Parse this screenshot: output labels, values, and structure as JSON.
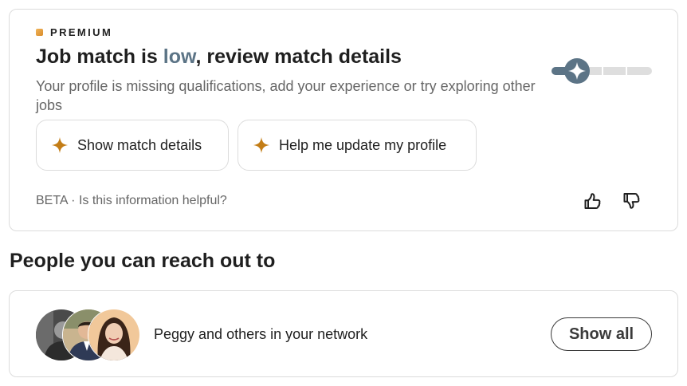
{
  "premium_card": {
    "badge": "PREMIUM",
    "headline_prefix": "Job match is ",
    "headline_highlight": "low",
    "headline_suffix": ", review match details",
    "subtitle": "Your profile is missing qualifications, add your experience or try exploring other jobs",
    "buttons": [
      {
        "label": "Show match details",
        "icon": "sparkle-icon"
      },
      {
        "label": "Help me update my profile",
        "icon": "sparkle-icon"
      }
    ],
    "match_level": "low",
    "footer": "BETA · Is this information helpful?",
    "feedback_icons": [
      "thumbs-up-icon",
      "thumbs-down-icon"
    ]
  },
  "people_section": {
    "title": "People you can reach out to",
    "network_text": "Peggy and others in your network",
    "show_all_label": "Show all",
    "avatars": [
      "avatar-person-1",
      "avatar-person-2",
      "avatar-person-3"
    ]
  },
  "colors": {
    "accent_low": "#5c7486",
    "sparkle": "#c37d16",
    "premium_gold": "#e3a23c"
  }
}
